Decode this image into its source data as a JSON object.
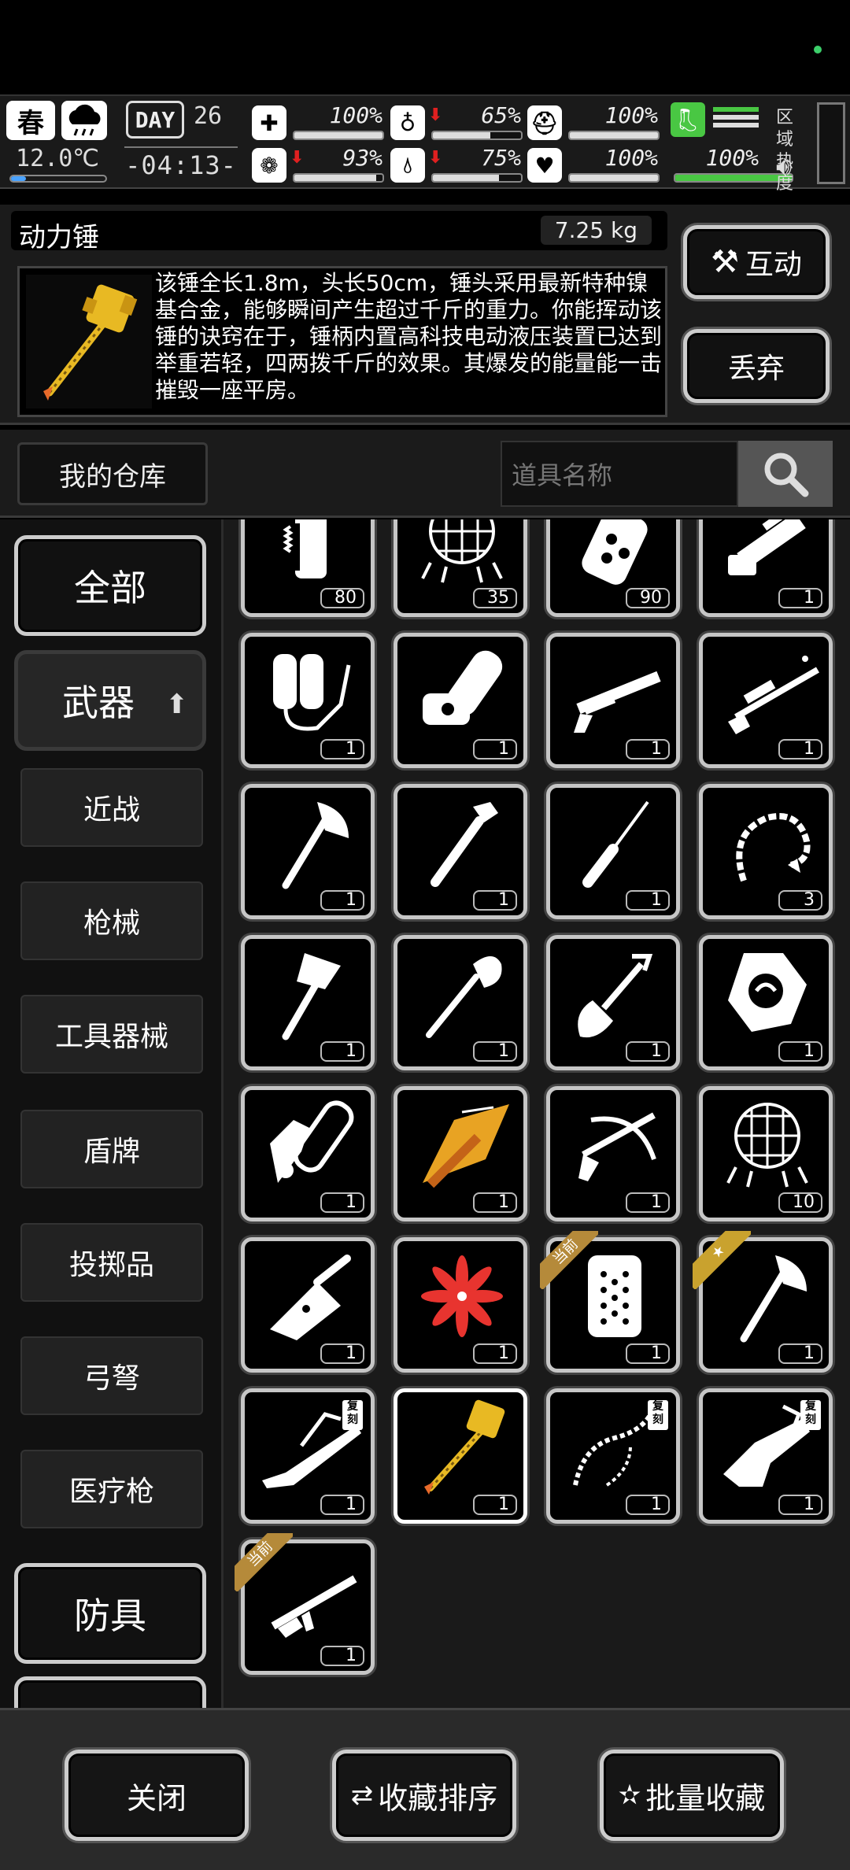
{
  "hud": {
    "season": "春",
    "temperature": "12.0℃",
    "day_label": "DAY",
    "day_number": "26",
    "clock": "-04:13-",
    "stats": [
      {
        "name": "health-kit",
        "pct": "100%",
        "value": 1.0,
        "icon": "medkit-icon",
        "arrow": false
      },
      {
        "name": "hunger",
        "pct": "65%",
        "value": 0.65,
        "icon": "stomach-icon",
        "arrow": true
      },
      {
        "name": "armor",
        "pct": "100%",
        "value": 1.0,
        "icon": "helmet-icon",
        "arrow": false
      },
      {
        "name": "sanity",
        "pct": "93%",
        "value": 0.93,
        "icon": "brain-icon",
        "arrow": true
      },
      {
        "name": "thirst",
        "pct": "75%",
        "value": 0.75,
        "icon": "water-drop-icon",
        "arrow": true
      },
      {
        "name": "heart",
        "pct": "100%",
        "value": 1.0,
        "icon": "heart-icon",
        "arrow": false
      },
      {
        "name": "stamina",
        "pct": "100%",
        "value": 1.0,
        "icon": "boot-icon",
        "arrow": false
      }
    ],
    "zone_label": "区域热度"
  },
  "detail": {
    "name": "动力锤",
    "weight": "7.25 kg",
    "description": "该锤全长1.8m，头长50cm，锤头采用最新特种镍基合金，能够瞬间产生超过千斤的重力。你能挥动该锤的诀窍在于，锤柄内置高科技电动液压装置已达到举重若轻，四两拨千斤的效果。其爆发的能量能一击摧毁一座平房。",
    "interact_label": "互动",
    "discard_label": "丢弃"
  },
  "warehouse": {
    "title": "我的仓库",
    "search_placeholder": "道具名称"
  },
  "sidebar": {
    "all": "全部",
    "weapons": "武器",
    "subs": [
      "近战",
      "枪械",
      "工具器械",
      "盾牌",
      "投掷品",
      "弓弩",
      "医疗枪"
    ],
    "armor": "防具"
  },
  "items": [
    {
      "icon": "grenade-icon",
      "count": "80"
    },
    {
      "icon": "net-icon",
      "count": "35"
    },
    {
      "icon": "frag-grenade-icon",
      "count": "90"
    },
    {
      "icon": "minigun-icon",
      "count": "1"
    },
    {
      "icon": "flamethrower-icon",
      "count": "1"
    },
    {
      "icon": "chainsaw-icon",
      "count": "1"
    },
    {
      "icon": "shotgun-icon",
      "count": "1"
    },
    {
      "icon": "sniper-rifle-icon",
      "count": "1"
    },
    {
      "icon": "axe-icon",
      "count": "1"
    },
    {
      "icon": "pipe-wrench-icon",
      "count": "1"
    },
    {
      "icon": "screwdriver-icon",
      "count": "1"
    },
    {
      "icon": "whip-icon",
      "count": "3"
    },
    {
      "icon": "hatchet-icon",
      "count": "1"
    },
    {
      "icon": "shovel-icon",
      "count": "1"
    },
    {
      "icon": "spade-icon",
      "count": "1"
    },
    {
      "icon": "bear-trap-icon",
      "count": "1"
    },
    {
      "icon": "dragon-chainsaw-icon",
      "count": "1"
    },
    {
      "icon": "golden-blade-icon",
      "count": "1"
    },
    {
      "icon": "crossbow-icon",
      "count": "1"
    },
    {
      "icon": "net-icon",
      "count": "10"
    },
    {
      "icon": "cleaver-icon",
      "count": "1"
    },
    {
      "icon": "red-flower-icon",
      "count": "1"
    },
    {
      "icon": "riot-shield-icon",
      "count": "1",
      "ribbon": "当前"
    },
    {
      "icon": "axe-icon",
      "count": "1",
      "ribbon": "★"
    },
    {
      "icon": "dragon-rifle-icon",
      "count": "1",
      "copy": "复刻"
    },
    {
      "icon": "power-hammer-icon",
      "count": "1",
      "selected": true
    },
    {
      "icon": "chain-whip-icon",
      "count": "1",
      "copy": "复刻"
    },
    {
      "icon": "dragon-gun-icon",
      "count": "1",
      "copy": "复刻"
    },
    {
      "icon": "assault-rifle-icon",
      "count": "1",
      "ribbon": "当前"
    }
  ],
  "bottom": {
    "close": "关闭",
    "sort": "收藏排序",
    "batch": "批量收藏"
  },
  "colors": {
    "accent_green": "#49c743",
    "ribbon_gold": "#b58a3a",
    "hammer_gold": "#e8b923"
  }
}
